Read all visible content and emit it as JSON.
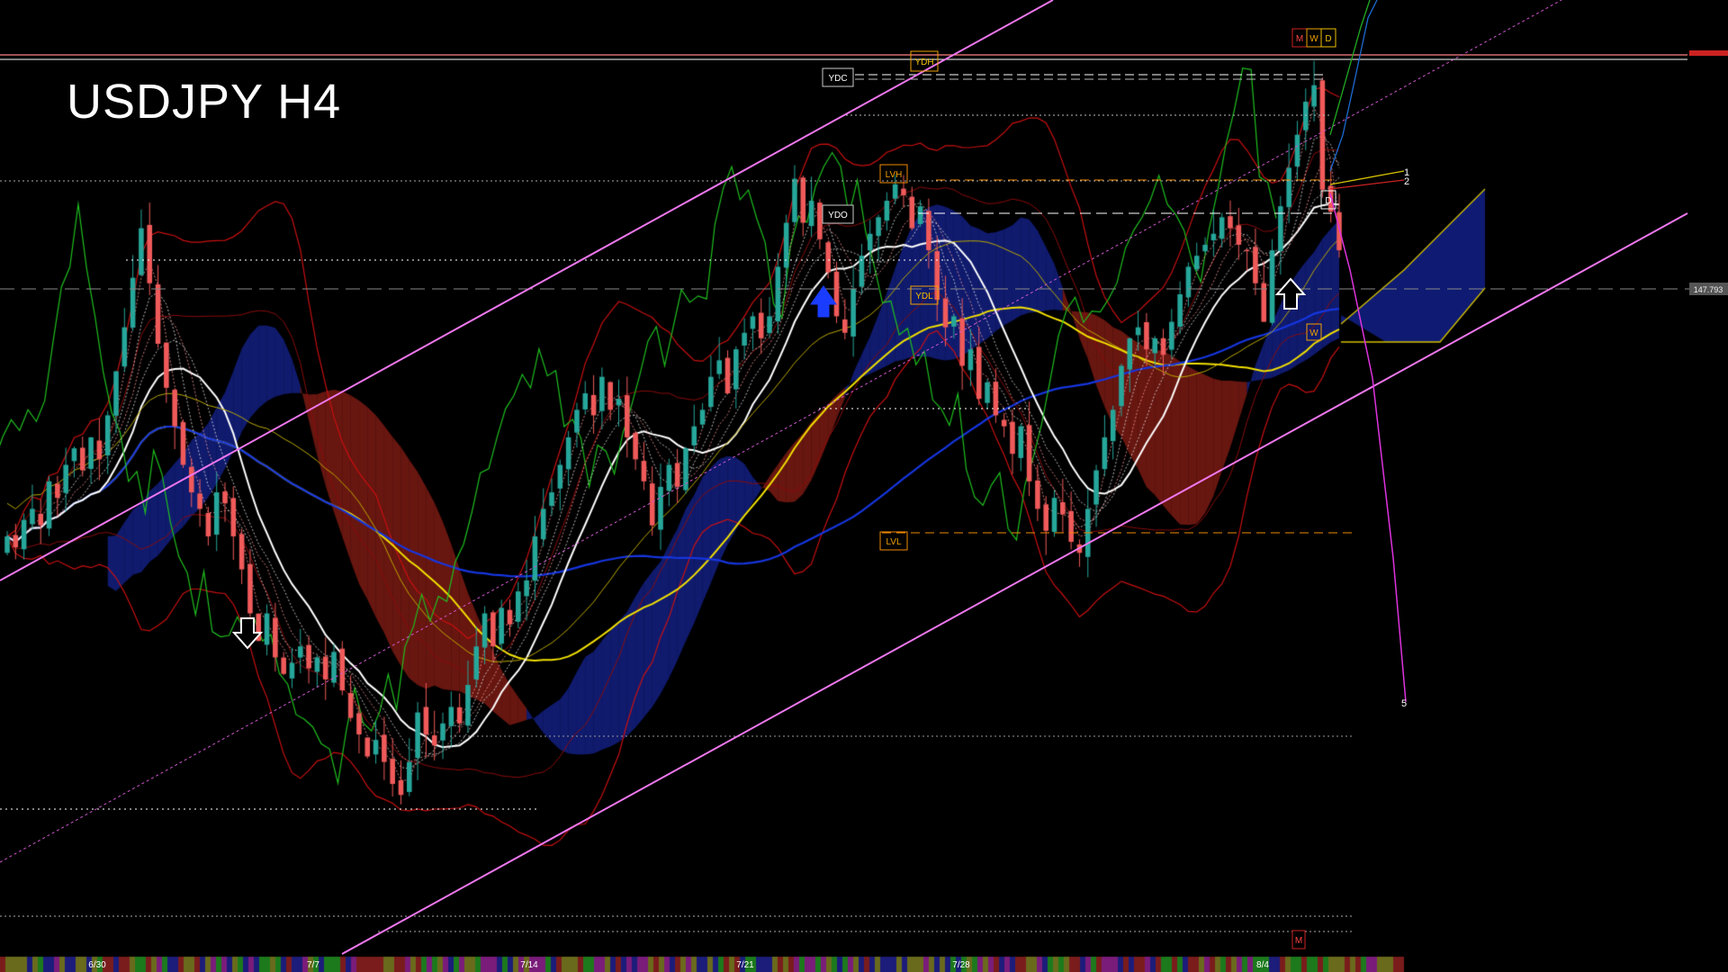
{
  "page": {
    "title": "USDJPY H4"
  },
  "chart_data": {
    "type": "candlestick",
    "symbol": "USDJPY",
    "timeframe": "H4",
    "x_tick_labels": [
      "6/30",
      "7/7",
      "7/14",
      "7/21",
      "7/28",
      "8/4"
    ],
    "price_label": "147.793",
    "level_labels": {
      "ydh": "YDH",
      "ydc": "YDC",
      "ydo": "YDO",
      "ydl": "YDL",
      "lvh": "LVH",
      "lvl": "LVL",
      "d_high": "D",
      "d_low": "D",
      "w": "W",
      "m_top": "M",
      "w_top": "W",
      "d_top": "D",
      "m_bottom": "M"
    },
    "projection_labels": [
      "1",
      "2",
      "5"
    ],
    "closes": [
      144.6,
      144.4,
      144.9,
      145.1,
      144.8,
      145.6,
      145.3,
      145.9,
      146.2,
      145.8,
      146.4,
      146.0,
      146.8,
      147.6,
      148.4,
      149.3,
      150.2,
      149.2,
      148.1,
      147.3,
      146.6,
      145.9,
      145.4,
      145.1,
      144.6,
      145.4,
      145.2,
      144.6,
      144.0,
      143.2,
      142.7,
      143.2,
      142.4,
      142.1,
      142.3,
      142.6,
      142.2,
      142.4,
      142.0,
      142.5,
      141.8,
      141.3,
      141.0,
      140.6,
      140.9,
      140.5,
      140.1,
      139.9,
      140.5,
      141.4,
      141.0,
      140.8,
      141.2,
      141.5,
      141.2,
      141.9,
      142.6,
      143.2,
      142.6,
      143.3,
      143.0,
      143.6,
      143.8,
      144.6,
      145.1,
      145.4,
      145.9,
      146.4,
      146.9,
      147.2,
      146.8,
      147.5,
      146.9,
      147.1,
      146.4,
      146.0,
      145.6,
      144.8,
      145.5,
      145.9,
      145.5,
      146.2,
      146.6,
      146.9,
      147.5,
      147.8,
      147.2,
      148.0,
      148.3,
      148.6,
      148.2,
      148.6,
      149.5,
      150.3,
      151.1,
      150.3,
      150.7,
      150.0,
      149.4,
      148.6,
      148.3,
      149.1,
      149.7,
      150.1,
      150.4,
      150.7,
      151.0,
      150.8,
      150.2,
      150.6,
      149.8,
      148.9,
      148.4,
      148.6,
      147.7,
      148.0,
      147.1,
      147.4,
      146.8,
      146.6,
      146.1,
      146.6,
      145.6,
      145.1,
      144.7,
      145.3,
      145.0,
      144.5,
      144.3,
      145.1,
      145.8,
      146.4,
      146.9,
      147.7,
      148.2,
      148.4,
      148.0,
      148.2,
      147.9,
      148.5,
      149.0,
      149.5,
      149.7,
      149.9,
      150.1,
      150.4,
      150.2,
      149.9,
      149.8,
      149.2,
      148.5,
      149.8,
      150.6,
      151.3,
      151.9,
      152.5,
      152.8,
      150.9,
      150.5,
      149.8
    ]
  }
}
